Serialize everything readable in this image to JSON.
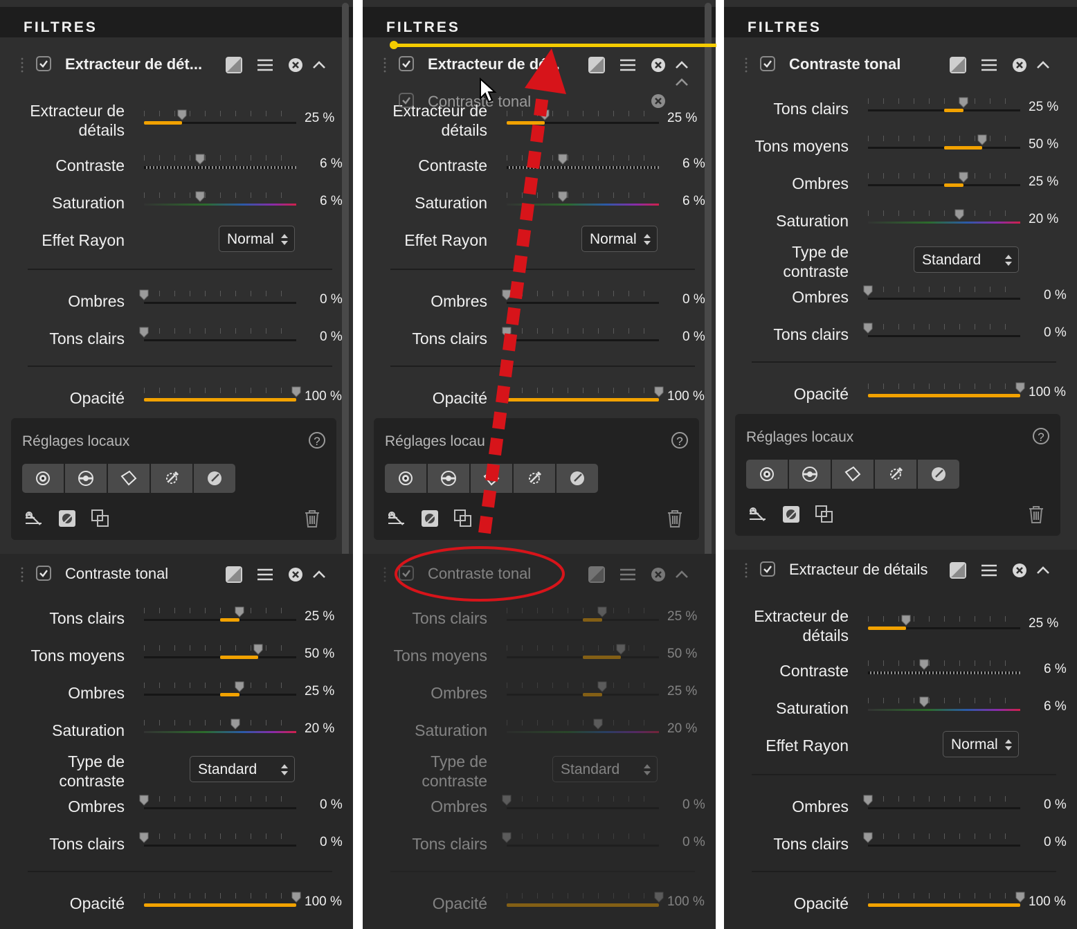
{
  "title": "FILTRES",
  "percent_sign": "%",
  "detail_filter": {
    "title_truncated": "Extracteur de dét...",
    "title_drag": "Extracteur de dé...",
    "title_full": "Extracteur de détails",
    "extracteur_label": "Extracteur de détails",
    "extracteur_value": "25 %",
    "extracteur_fraction": 0.25,
    "contraste_label": "Contraste",
    "contraste_value": "6 %",
    "contraste_fraction": 0.06,
    "saturation_label": "Saturation",
    "saturation_value": "6 %",
    "saturation_fraction": 0.06,
    "effet_label": "Effet Rayon",
    "effet_value": "Normal",
    "ombres_label": "Ombres",
    "ombres_value": "0 %",
    "tons_clairs_label": "Tons clairs",
    "tons_clairs_value": "0 %",
    "opacite_label": "Opacité",
    "opacite_value": "100 %"
  },
  "tonal_filter": {
    "title": "Contraste tonal",
    "tons_clairs_label": "Tons clairs",
    "tons_clairs_value": "25 %",
    "tons_clairs_fraction": 0.25,
    "tons_moyens_label": "Tons moyens",
    "tons_moyens_value": "50 %",
    "tons_moyens_fraction": 0.5,
    "ombres_label": "Ombres",
    "ombres_value": "25 %",
    "ombres_fraction": 0.25,
    "saturation_label": "Saturation",
    "saturation_value": "20 %",
    "saturation_fraction": 0.2,
    "type_label": "Type de contraste",
    "type_value": "Standard",
    "ombres2_label": "Ombres",
    "ombres2_value": "0 %",
    "tons_clairs2_label": "Tons clairs",
    "tons_clairs2_value": "0 %",
    "opacite_label": "Opacité",
    "opacite_value": "100 %"
  },
  "local": {
    "title": "Réglages locaux",
    "title_clipped": "Réglages locau",
    "help": "?",
    "tools": [
      "control-point-icon",
      "selective-brush-icon",
      "lasso-polygon-icon",
      "gradient-brush-icon",
      "auto-brush-icon"
    ]
  },
  "drag_ghost": {
    "title": "Contraste tonal"
  },
  "colors": {
    "accent": "#f2a200",
    "drag_indicator": "#f5cc00",
    "annotation": "#d7141a"
  }
}
